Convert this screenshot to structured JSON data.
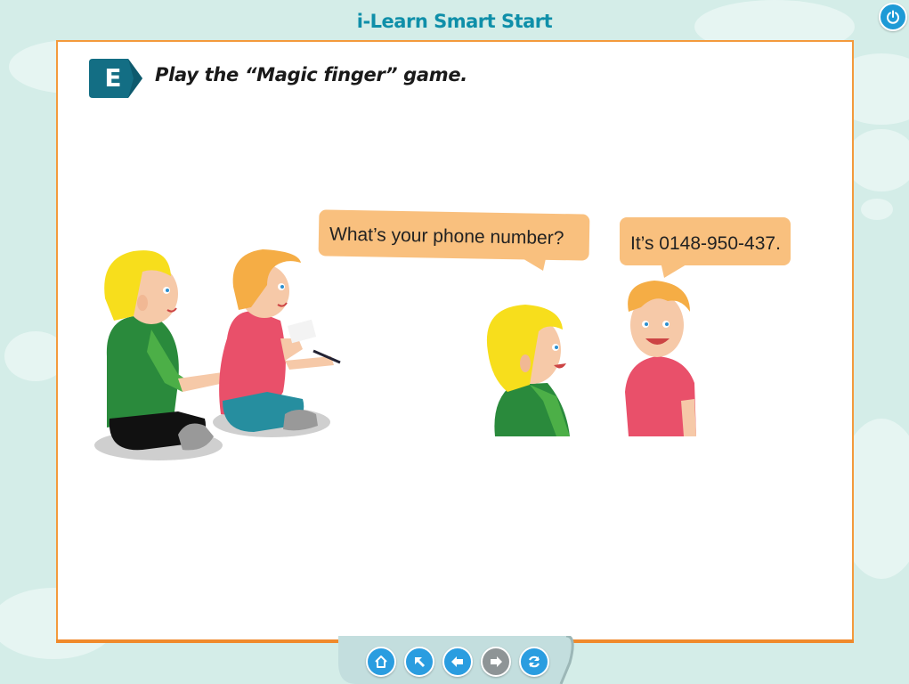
{
  "app": {
    "title": "i-Learn Smart Start"
  },
  "header": {
    "power_icon": "power-icon"
  },
  "activity": {
    "badge_letter": "E",
    "instruction": "Play the “Magic finger” game."
  },
  "dialogue": {
    "question": "What’s your phone number?",
    "answer": "It’s 0148-950-437."
  },
  "navigation": {
    "buttons": [
      {
        "icon": "home-icon",
        "color": "#2a9de0"
      },
      {
        "icon": "arrow-up-left-icon",
        "color": "#2a9de0"
      },
      {
        "icon": "arrow-left-icon",
        "color": "#2a9de0"
      },
      {
        "icon": "arrow-right-icon",
        "color": "#8e9496"
      },
      {
        "icon": "refresh-icon",
        "color": "#2a9de0"
      }
    ]
  },
  "colors": {
    "panel_border": "#f39a3c",
    "title": "#0f8fa9",
    "bubble": "#f9c07e",
    "background": "#d4ede8"
  }
}
